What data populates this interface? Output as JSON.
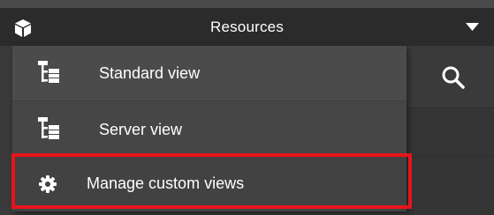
{
  "header": {
    "title": "Resources",
    "cube_icon": "cube-icon",
    "dropdown_icon": "caret-down-icon"
  },
  "toolbar": {
    "search_icon": "search-icon"
  },
  "menu": {
    "items": [
      {
        "label": "Standard view",
        "icon": "tree-view-icon"
      },
      {
        "label": "Server view",
        "icon": "tree-view-icon"
      },
      {
        "label": "Manage custom views",
        "icon": "gear-icon"
      }
    ]
  },
  "annotation": {
    "highlight_color": "#e8141c"
  },
  "colors": {
    "header_bg": "#2b2b2b",
    "menu_bg": "#4a4a4a",
    "text": "#ffffff"
  }
}
